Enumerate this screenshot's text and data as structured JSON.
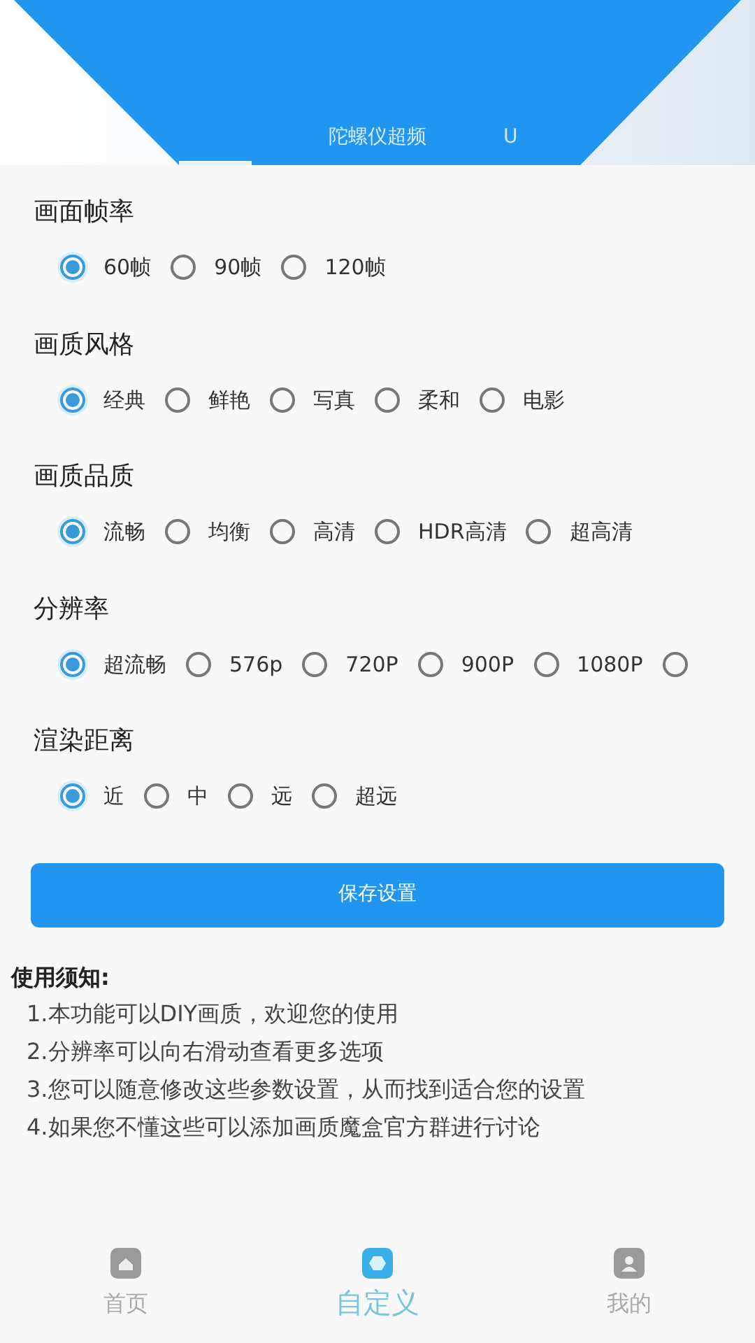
{
  "tabs": [
    {
      "selected": true
    },
    {
      "label": "陀螺仪超频",
      "selected": false
    },
    {
      "label": "U",
      "selected": false
    }
  ],
  "groups": [
    {
      "title": "画面帧率",
      "options": [
        {
          "label": "60帧",
          "selected": true
        },
        {
          "label": "90帧",
          "selected": false
        },
        {
          "label": "120帧",
          "selected": false
        }
      ]
    },
    {
      "title": "画质风格",
      "options": [
        {
          "label": "经典",
          "selected": true
        },
        {
          "label": "鲜艳",
          "selected": false
        },
        {
          "label": "写真",
          "selected": false
        },
        {
          "label": "柔和",
          "selected": false
        },
        {
          "label": "电影",
          "selected": false
        }
      ]
    },
    {
      "title": "画质品质",
      "options": [
        {
          "label": "流畅",
          "selected": true
        },
        {
          "label": "均衡",
          "selected": false
        },
        {
          "label": "高清",
          "selected": false
        },
        {
          "label": "HDR高清",
          "selected": false
        },
        {
          "label": "超高清",
          "selected": false
        }
      ]
    },
    {
      "title": "分辨率",
      "options": [
        {
          "label": "超流畅",
          "selected": true
        },
        {
          "label": "576p",
          "selected": false
        },
        {
          "label": "720P",
          "selected": false
        },
        {
          "label": "900P",
          "selected": false
        },
        {
          "label": "1080P",
          "selected": false
        },
        {
          "selected": false
        }
      ]
    },
    {
      "title": "渲染距离",
      "options": [
        {
          "label": "近",
          "selected": true
        },
        {
          "label": "中",
          "selected": false
        },
        {
          "label": "远",
          "selected": false
        },
        {
          "label": "超远",
          "selected": false
        }
      ]
    }
  ],
  "save_button": "保存设置",
  "notice": {
    "title": "使用须知:",
    "lines": [
      "1.本功能可以DIY画质，欢迎您的使用",
      "2.分辨率可以向右滑动查看更多选项",
      "3.您可以随意修改这些参数设置，从而找到适合您的设置",
      "4.如果您不懂这些可以添加画质魔盒官方群进行讨论"
    ]
  },
  "nav": [
    {
      "kind": "home",
      "label": "首页",
      "selected": false
    },
    {
      "kind": "custom",
      "label": "自定义",
      "selected": true
    },
    {
      "kind": "profile",
      "label": "我的",
      "selected": false
    }
  ]
}
